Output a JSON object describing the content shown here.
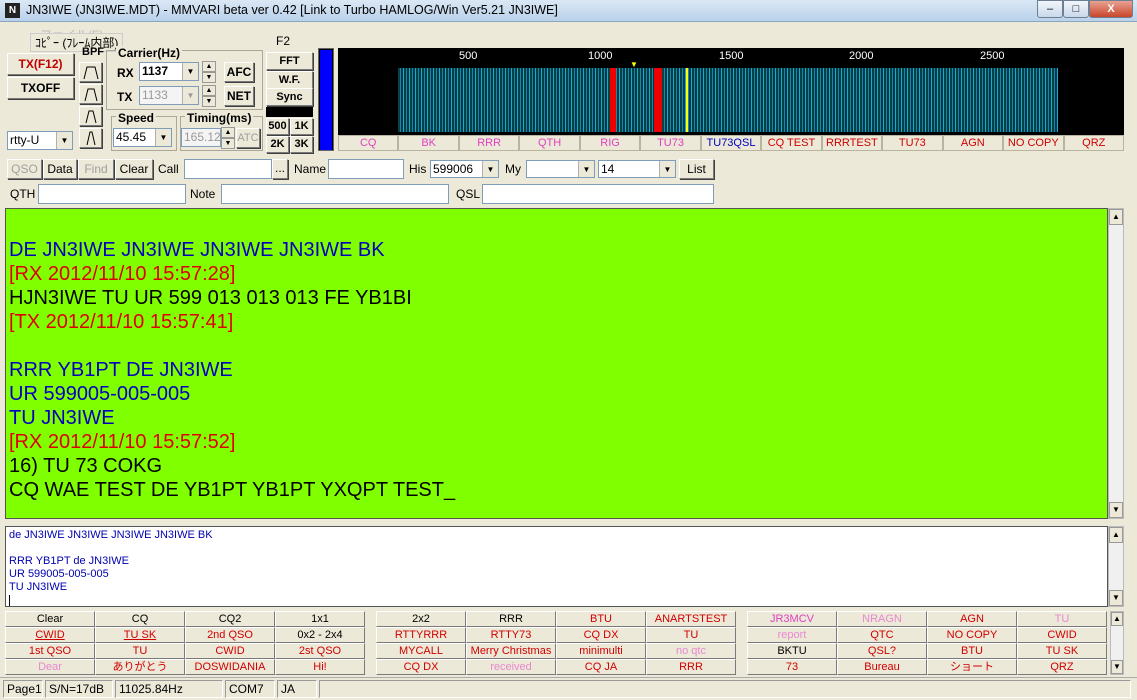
{
  "window": {
    "title": "JN3IWE (JN3IWE.MDT) - MMVARI beta ver 0.42 [Link to Turbo HAMLOG/Win Ver5.21 JN3IWE]",
    "icon_letter": "N",
    "min_label": "–",
    "max_label": "□",
    "close_label": "X"
  },
  "menubar": {
    "ghost_text": "ファイル(F)",
    "overlay_text": "ｺﾋﾟｰ (ﾌﾚｰﾑ内部)"
  },
  "controls": {
    "tx_label": "TX(F12)",
    "txoff_label": "TXOFF",
    "mode_value": "rtty-U",
    "bpf_label": "BPF",
    "carrier_label": "Carrier(Hz)",
    "rx_label": "RX",
    "rx_value": "1137",
    "tx_field_label": "TX",
    "tx_value": "1133",
    "afc_label": "AFC",
    "net_label": "NET",
    "speed_label": "Speed",
    "speed_value": "45.45",
    "timing_label": "Timing(ms)",
    "timing_value": "165.12",
    "atc_label": "ATC",
    "f2_label": "F2",
    "fft_label": "FFT",
    "wf_label": "W.F.",
    "sync_label": "Sync",
    "bw": [
      "500",
      "1K",
      "2K",
      "3K"
    ]
  },
  "waterfall": {
    "ticks": [
      "500",
      "1000",
      "1500",
      "2000",
      "2500"
    ],
    "bg_color": "#000000",
    "signal_color": "#0aa0a0"
  },
  "macro_bar": [
    {
      "label": "CQ",
      "color": "m"
    },
    {
      "label": "BK",
      "color": "m"
    },
    {
      "label": "RRR",
      "color": "m"
    },
    {
      "label": "QTH",
      "color": "m"
    },
    {
      "label": "RIG",
      "color": "m"
    },
    {
      "label": "TU73",
      "color": "m"
    },
    {
      "label": "TU73QSL",
      "color": "b"
    },
    {
      "label": "CQ TEST",
      "color": "r"
    },
    {
      "label": "RRRTEST",
      "color": "r"
    },
    {
      "label": "TU73",
      "color": "r"
    },
    {
      "label": "AGN",
      "color": "r"
    },
    {
      "label": "NO COPY",
      "color": "r"
    },
    {
      "label": "QRZ",
      "color": "r"
    }
  ],
  "log": {
    "qso": "QSO",
    "data": "Data",
    "find": "Find",
    "clear": "Clear",
    "call_label": "Call",
    "call_value": "",
    "dots": "...",
    "name_label": "Name",
    "his_label": "His",
    "his_value": "599006",
    "my_label": "My",
    "my_value": "",
    "band_value": "14",
    "list": "List",
    "qth_label": "QTH",
    "note_label": "Note",
    "qsl_label": "QSL"
  },
  "rx_lines": [
    {
      "text": "DE JN3IWE JN3IWE JN3IWE JN3IWE BK",
      "cls": "blue"
    },
    {
      "text": "[RX 2012/11/10 15:57:28]",
      "cls": "redt"
    },
    {
      "text": "HJN3IWE TU UR 599 013 013 013 FE YB1BI",
      "cls": ""
    },
    {
      "text": "[TX 2012/11/10 15:57:41]",
      "cls": "redt"
    },
    {
      "text": "",
      "cls": ""
    },
    {
      "text": "RRR YB1PT DE JN3IWE",
      "cls": "blue"
    },
    {
      "text": "UR 599005-005-005",
      "cls": "blue"
    },
    {
      "text": "TU JN3IWE",
      "cls": "blue"
    },
    {
      "text": "[RX 2012/11/10 15:57:52]",
      "cls": "redt"
    },
    {
      "text": "16) TU 73 COKG",
      "cls": ""
    },
    {
      "text": "CQ WAE TEST DE YB1PT YB1PT YXQPT TEST_",
      "cls": ""
    }
  ],
  "tx_lines": [
    "de JN3IWE JN3IWE JN3IWE JN3IWE BK",
    "",
    "RRR YB1PT de JN3IWE",
    "UR 599005-005-005",
    "TU JN3IWE"
  ],
  "macros_a": [
    [
      "Clear",
      "k"
    ],
    [
      "CQ",
      "k"
    ],
    [
      "CQ2",
      "k"
    ],
    [
      "1x1",
      "k"
    ],
    [
      "CWID",
      "u"
    ],
    [
      "TU SK",
      "u"
    ],
    [
      "2nd QSO",
      "r"
    ],
    [
      "0x2 - 2x4",
      "k"
    ],
    [
      "1st QSO",
      "r"
    ],
    [
      "TU",
      "r"
    ],
    [
      "CWID",
      "r"
    ],
    [
      "2st QSO",
      "r"
    ],
    [
      "Dear",
      "p"
    ],
    [
      "ありがとう",
      "r"
    ],
    [
      "DOSWIDANIA",
      "r"
    ],
    [
      "Hi!",
      "r"
    ]
  ],
  "macros_b": [
    [
      "2x2",
      "k"
    ],
    [
      "RRR",
      "k"
    ],
    [
      "BTU",
      "r"
    ],
    [
      "ANARTSTEST",
      "r"
    ],
    [
      "RTTYRRR",
      "r"
    ],
    [
      "RTTY73",
      "r"
    ],
    [
      "CQ DX",
      "r"
    ],
    [
      "TU",
      "r"
    ],
    [
      "MYCALL",
      "r"
    ],
    [
      "Merry Christmas",
      "r"
    ],
    [
      "minimulti",
      "r"
    ],
    [
      "no qtc",
      "p"
    ],
    [
      "CQ DX",
      "r"
    ],
    [
      "received",
      "p"
    ],
    [
      "CQ JA",
      "r"
    ],
    [
      "RRR",
      "r"
    ]
  ],
  "macros_c": [
    [
      "JR3MCV",
      "m"
    ],
    [
      "NRAGN",
      "p"
    ],
    [
      "AGN",
      "r"
    ],
    [
      "TU",
      "p"
    ],
    [
      "report",
      "p"
    ],
    [
      "QTC",
      "r"
    ],
    [
      "NO COPY",
      "r"
    ],
    [
      "CWID",
      "r"
    ],
    [
      "BKTU",
      "k"
    ],
    [
      "QSL?",
      "r"
    ],
    [
      "BTU",
      "r"
    ],
    [
      "TU SK",
      "r"
    ],
    [
      "73",
      "r"
    ],
    [
      "Bureau",
      "r"
    ],
    [
      "ショート",
      "r"
    ],
    [
      "QRZ",
      "r"
    ]
  ],
  "status": {
    "page": "Page1",
    "sn": "S/N=17dB",
    "freq": "11025.84Hz",
    "port": "COM7",
    "lang": "JA"
  }
}
